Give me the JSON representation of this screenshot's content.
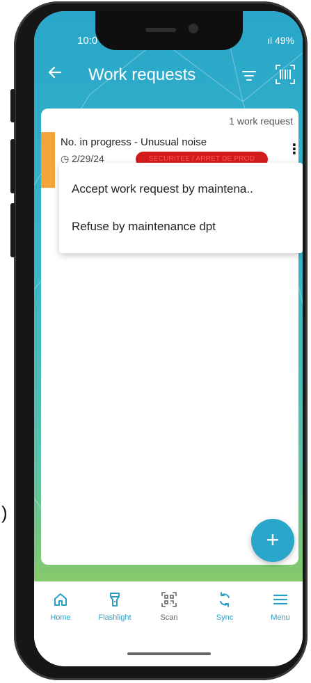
{
  "status_bar": {
    "time": "10:0",
    "right": "ıl 49%"
  },
  "header": {
    "title": "Work requests"
  },
  "list": {
    "count_label": "1 work request",
    "items": [
      {
        "title": "No. in progress - Unusual noise",
        "date": "2/29/24",
        "badge": "SECURITEE / ARRET DE PROD"
      }
    ]
  },
  "context_menu": {
    "items": [
      "Accept work request by maintena..",
      "Refuse by maintenance dpt"
    ]
  },
  "fab": {
    "label": "+"
  },
  "bottom_nav": {
    "items": [
      {
        "label": "Home"
      },
      {
        "label": "Flashlight"
      },
      {
        "label": "Scan"
      },
      {
        "label": "Sync"
      },
      {
        "label": "Menu"
      }
    ]
  },
  "stray_text": ")",
  "colors": {
    "accent": "#29a6c9",
    "row_stripe": "#f4a53a",
    "badge": "#d41c1c",
    "gradient_end": "#86c96a"
  }
}
